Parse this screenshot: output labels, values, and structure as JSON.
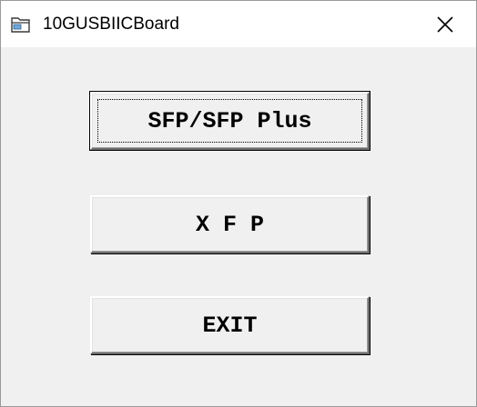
{
  "window": {
    "title": "10GUSBIICBoard",
    "app_icon": "folder-icon",
    "close_icon": "close-icon"
  },
  "buttons": {
    "sfp_label": "SFP/SFP Plus",
    "xfp_label": "X F P",
    "exit_label": "EXIT"
  },
  "colors": {
    "titlebar": "#ffffff",
    "client": "#f0f0f0",
    "text": "#000000"
  }
}
